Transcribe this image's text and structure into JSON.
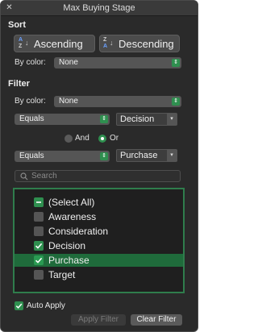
{
  "window": {
    "title": "Max Buying Stage",
    "close_glyph": "✕"
  },
  "sort": {
    "heading": "Sort",
    "ascending_label": "Ascending",
    "descending_label": "Descending",
    "by_color_label": "By color:",
    "by_color_value": "None"
  },
  "filter": {
    "heading": "Filter",
    "by_color_label": "By color:",
    "by_color_value": "None",
    "condition1": {
      "operator": "Equals",
      "value": "Decision"
    },
    "logic": {
      "and_label": "And",
      "or_label": "Or",
      "selected": "Or"
    },
    "condition2": {
      "operator": "Equals",
      "value": "Purchase"
    },
    "search_placeholder": "Search",
    "items": [
      {
        "label": "(Select All)",
        "state": "mixed",
        "selected": false
      },
      {
        "label": "Awareness",
        "state": "unchecked",
        "selected": false
      },
      {
        "label": "Consideration",
        "state": "unchecked",
        "selected": false
      },
      {
        "label": "Decision",
        "state": "checked",
        "selected": false
      },
      {
        "label": "Purchase",
        "state": "checked",
        "selected": true
      },
      {
        "label": "Target",
        "state": "unchecked",
        "selected": false
      }
    ]
  },
  "auto_apply": {
    "label": "Auto Apply",
    "checked": true
  },
  "buttons": {
    "apply_label": "Apply Filter",
    "clear_label": "Clear Filter"
  },
  "colors": {
    "accent_green": "#2f8f4f",
    "selection_green": "#1f6b3b",
    "panel_bg": "#2a2a2a"
  },
  "icons": {
    "close": "close-icon",
    "ascending": "sort-ascending-icon",
    "descending": "sort-descending-icon",
    "search": "search-icon",
    "stepper": "stepper-icon",
    "dropdown": "dropdown-arrow-icon"
  }
}
